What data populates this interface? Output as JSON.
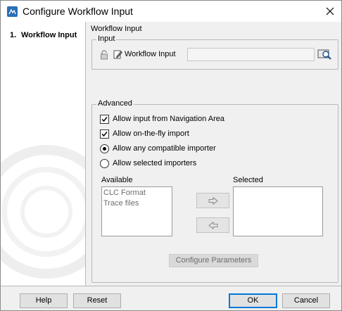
{
  "window": {
    "title": "Configure Workflow Input",
    "accent": "#2a6fb8"
  },
  "wizard": {
    "steps": [
      {
        "number": "1.",
        "label": "Workflow Input"
      }
    ]
  },
  "main": {
    "section_title": "Workflow Input",
    "input_group": {
      "legend": "Input",
      "field_label": "Workflow Input",
      "field_value": "",
      "icons": [
        "lock-icon",
        "edit-icon",
        "browse-icon"
      ]
    },
    "advanced_group": {
      "legend": "Advanced",
      "options": [
        {
          "label": "Allow input from Navigation Area",
          "type": "checkbox",
          "checked": true
        },
        {
          "label": "Allow on-the-fly import",
          "type": "checkbox",
          "checked": true
        },
        {
          "label": "Allow any compatible importer",
          "type": "radio",
          "checked": true
        },
        {
          "label": "Allow selected importers",
          "type": "radio",
          "checked": false
        }
      ],
      "available_label": "Available",
      "available_items": [
        "CLC Format",
        "Trace files"
      ],
      "selected_label": "Selected",
      "selected_items": [],
      "configure_button": "Configure Parameters"
    }
  },
  "footer": {
    "help": "Help",
    "reset": "Reset",
    "ok": "OK",
    "cancel": "Cancel"
  }
}
